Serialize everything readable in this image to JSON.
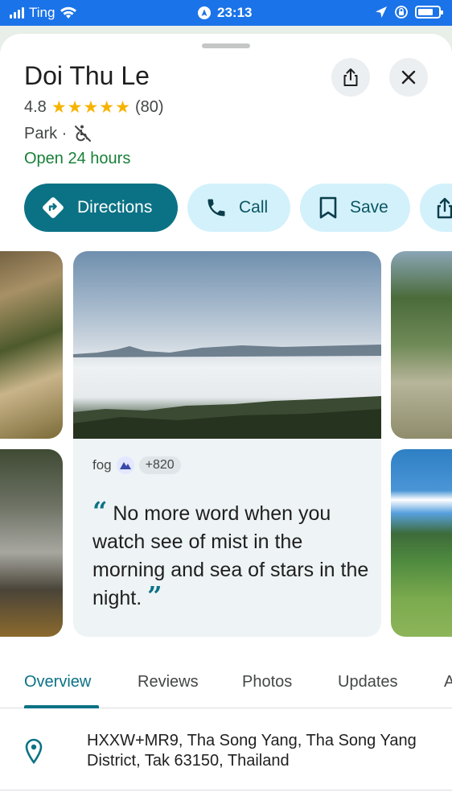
{
  "status_bar": {
    "carrier": "Ting",
    "time": "23:13"
  },
  "place": {
    "name": "Doi Thu Le",
    "rating": "4.8",
    "review_count": "(80)",
    "stars": 5,
    "type": "Park ·",
    "hours": "Open 24 hours"
  },
  "header_buttons": {
    "share_icon": "share-icon",
    "close_icon": "close-icon"
  },
  "actions": [
    {
      "label": "Directions",
      "icon": "directions-icon"
    },
    {
      "label": "Call",
      "icon": "phone-icon"
    },
    {
      "label": "Save",
      "icon": "bookmark-icon"
    }
  ],
  "review": {
    "author": "fog",
    "extra_count": "+820",
    "quote": "No more word when you watch see of mist in the morning and sea of stars in the night."
  },
  "tabs": [
    "Overview",
    "Reviews",
    "Photos",
    "Updates",
    "A"
  ],
  "active_tab": "Overview",
  "address": "HXXW+MR9, Tha Song Yang, Tha Song Yang District, Tak 63150, Thailand",
  "colors": {
    "accent": "#0b7285",
    "status_bar": "#1a73e8",
    "open_green": "#188038",
    "star": "#f6b400"
  }
}
